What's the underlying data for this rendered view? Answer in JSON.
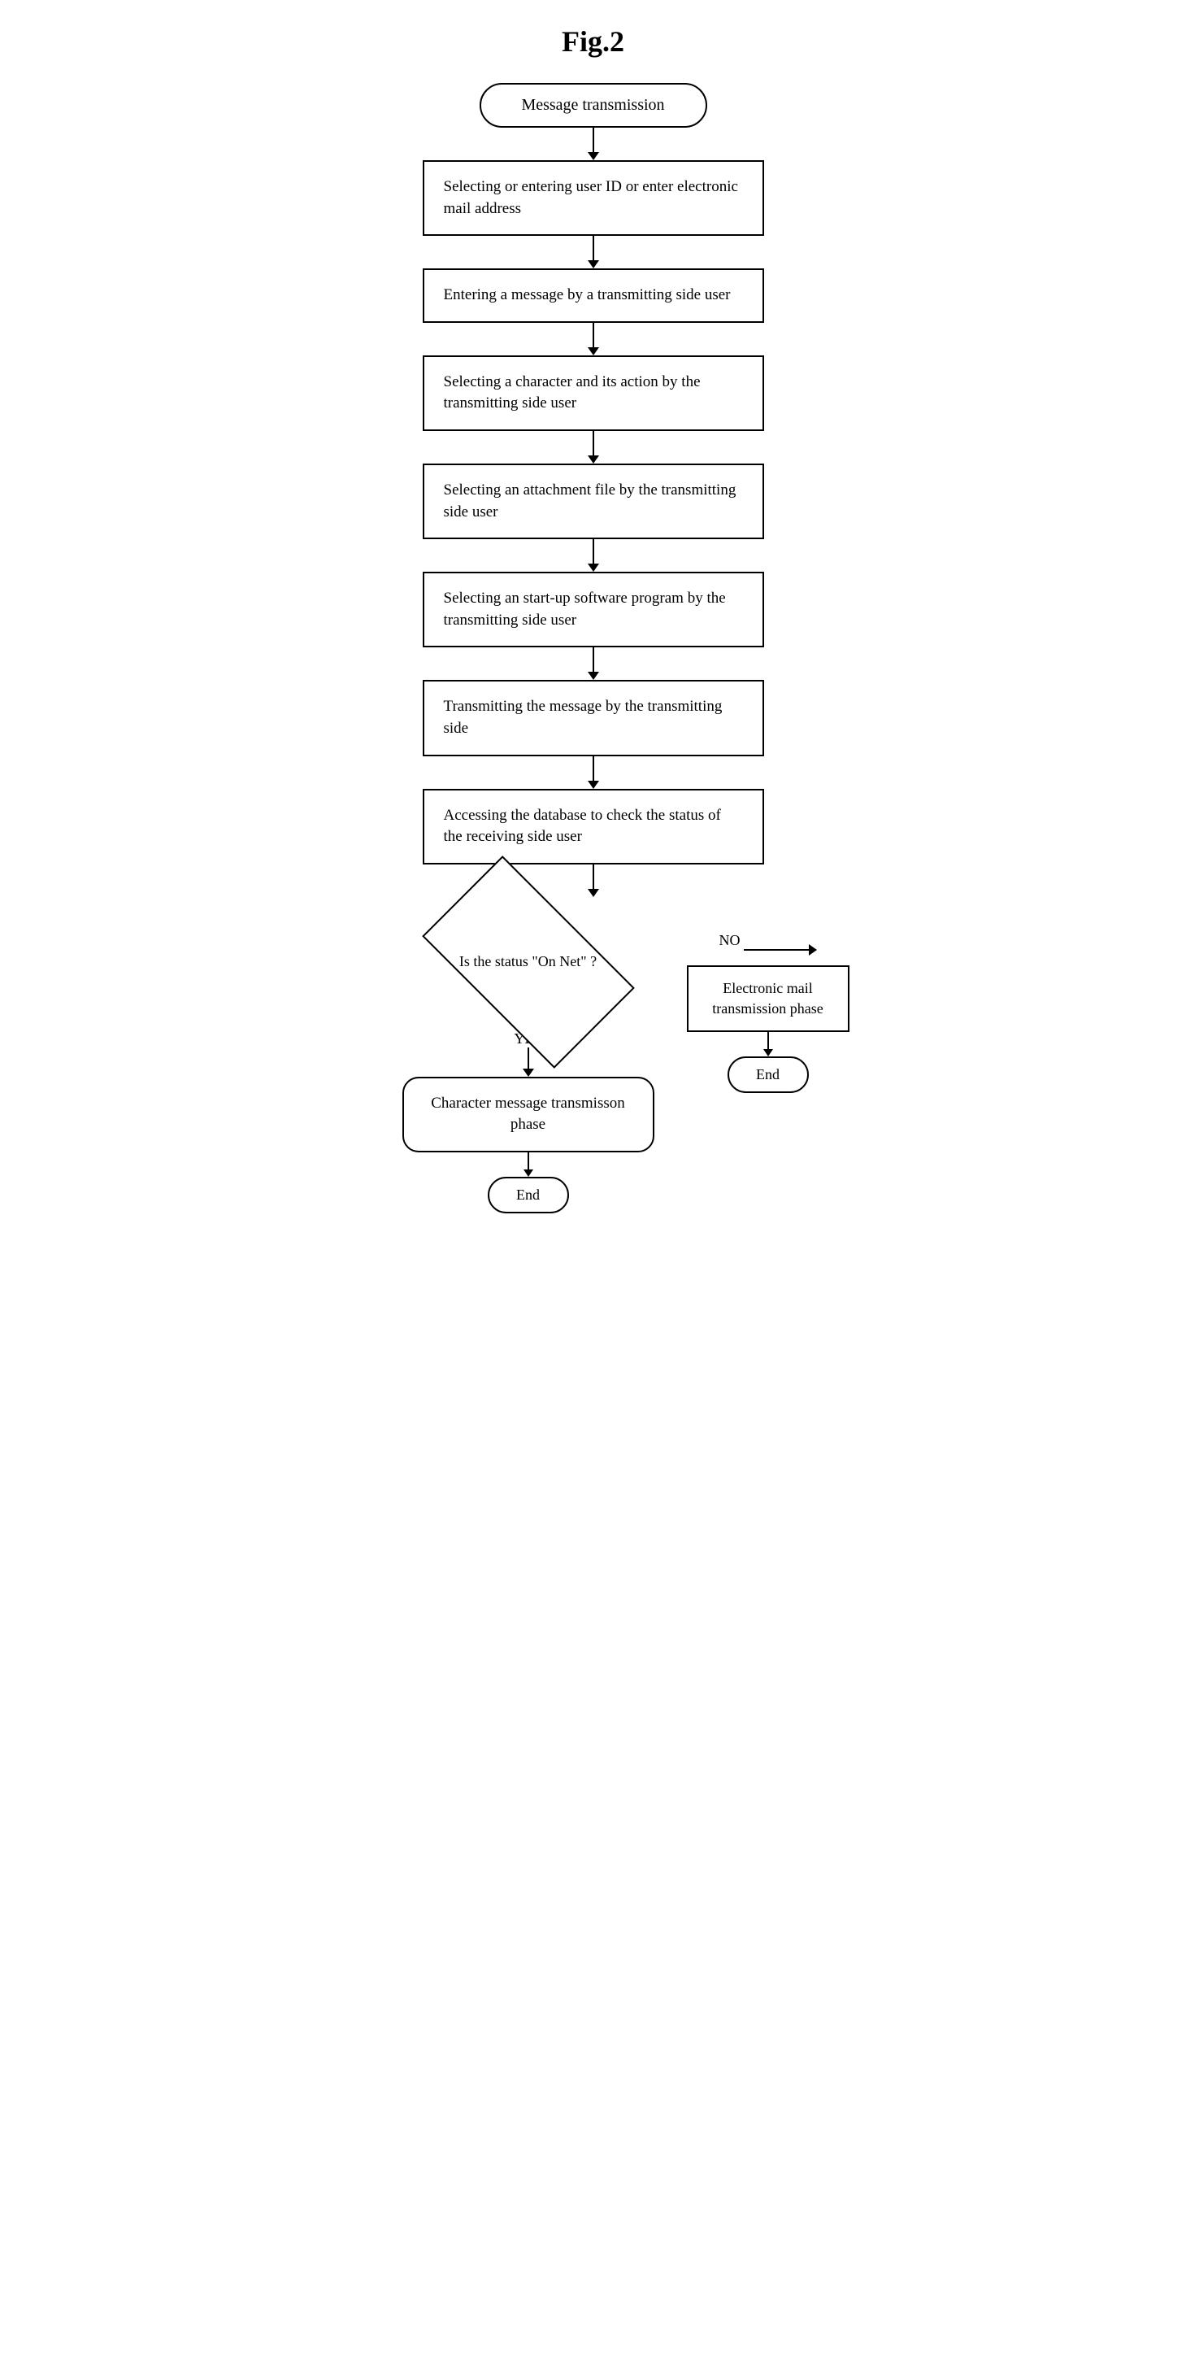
{
  "title": "Fig.2",
  "nodes": {
    "start": "Message transmission",
    "step1": "Selecting or entering user ID or enter electronic mail address",
    "step2": "Entering a message by a transmitting side user",
    "step3": "Selecting a character and its action by the transmitting side user",
    "step4": "Selecting an attachment file by the transmitting side user",
    "step5": "Selecting an start-up software program by the transmitting side user",
    "step6": "Transmitting the message by the transmitting side",
    "step7": "Accessing the database to check the status of the receiving side user",
    "decision": "Is the status \"On Net\" ?",
    "no_label": "NO",
    "yes_label": "YES",
    "right_box": "Electronic mail transmission phase",
    "right_end": "End",
    "left_phase": "Character message transmisson phase",
    "left_end": "End"
  }
}
